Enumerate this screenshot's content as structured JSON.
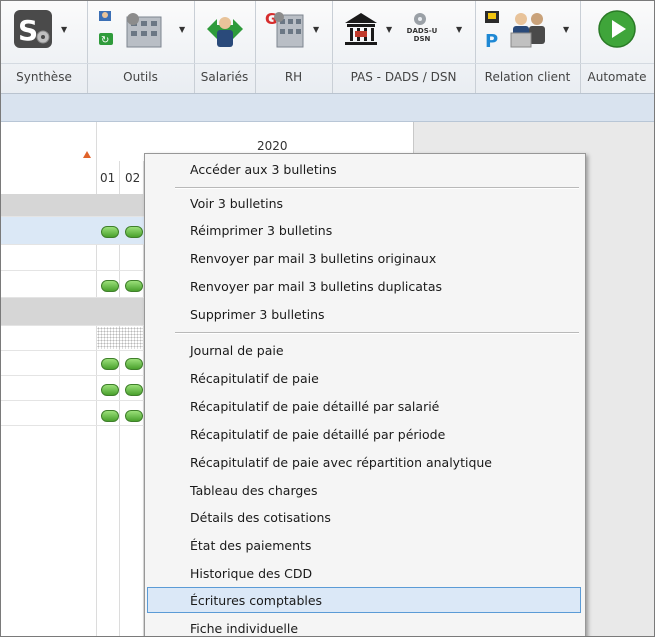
{
  "ribbon": {
    "groups": [
      {
        "label": "Synthèse",
        "icon": "synthese-icon"
      },
      {
        "label": "Outils",
        "icon": "tools-icon"
      },
      {
        "label": "Salariés",
        "icon": "employees-icon"
      },
      {
        "label": "RH",
        "icon": "hr-icon"
      },
      {
        "label": "PAS - DADS / DSN",
        "icon": "bank-icon",
        "icon2_text": "DADS-U DSN"
      },
      {
        "label": "Relation client",
        "icon": "customer-relation-icon"
      },
      {
        "label": "Automate",
        "icon": "play-icon"
      }
    ]
  },
  "grid": {
    "year": "2020",
    "columns": [
      "01",
      "02"
    ]
  },
  "context_menu": {
    "items": [
      {
        "label": "Accéder aux 3 bulletins"
      },
      {
        "label": "Voir 3 bulletins"
      },
      {
        "label": "Réimprimer 3 bulletins"
      },
      {
        "label": "Renvoyer par mail 3 bulletins originaux"
      },
      {
        "label": "Renvoyer par mail 3 bulletins duplicatas"
      },
      {
        "label": "Supprimer 3 bulletins"
      },
      {
        "label": "Journal de paie"
      },
      {
        "label": "Récapitulatif de paie"
      },
      {
        "label": "Récapitulatif de paie détaillé par salarié"
      },
      {
        "label": "Récapitulatif de paie détaillé par période"
      },
      {
        "label": "Récapitulatif de paie avec répartition analytique"
      },
      {
        "label": "Tableau des charges"
      },
      {
        "label": "Détails des cotisations"
      },
      {
        "label": "État des paiements"
      },
      {
        "label": "Historique des CDD"
      },
      {
        "label": "Écritures comptables",
        "highlighted": true
      },
      {
        "label": "Fiche individuelle"
      }
    ]
  },
  "colors": {
    "accent": "#5b9bd6",
    "status_green": "#4aa12d",
    "sort_arrow": "#e0632a"
  }
}
